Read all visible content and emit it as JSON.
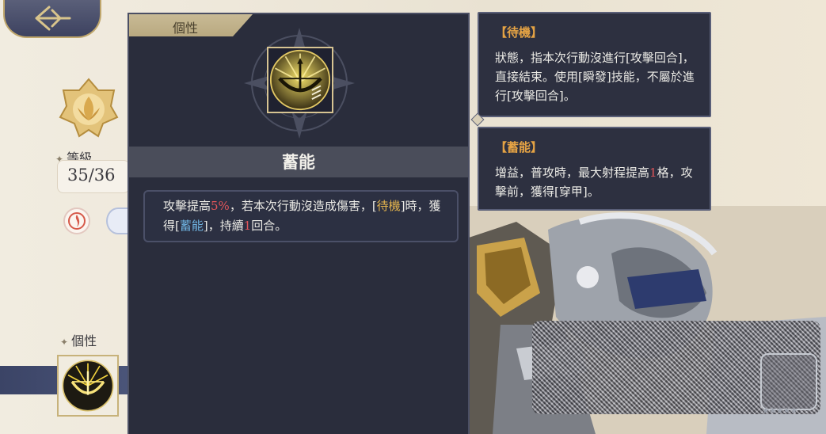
{
  "nav": {
    "back_icon": "back-arrow-icon"
  },
  "character": {
    "level_label": "等級",
    "level_value": "35/36",
    "trait_label": "個性"
  },
  "panel": {
    "tab_label": "個性",
    "skill_name": "蓄能",
    "description": {
      "p1": "攻擊提高",
      "pct": "5%",
      "p2": "，若本次行動沒造成傷害，[",
      "kw_standby": "待機",
      "p3": "]時，獲得[",
      "kw_charge": "蓄能",
      "p4": "]，持續",
      "turns": "1",
      "p5": "回合。"
    }
  },
  "tooltips": {
    "standby": {
      "title": "【待機】",
      "body": "狀態，指本次行動沒進行[攻擊回合]，直接結束。使用[瞬發]技能，不屬於進行[攻擊回合]。"
    },
    "charge": {
      "title": "【蓄能】",
      "body_a": "增益，普攻時，最大射程提高",
      "body_num": "1",
      "body_b": "格，攻擊前，獲得[穿甲]。"
    }
  },
  "colors": {
    "panel_bg": "#2a2d3c",
    "highlight_red": "#e0555a",
    "highlight_gold": "#e5b54d",
    "highlight_teal": "#6fb4e2",
    "tooltip_title": "#e5a344"
  }
}
